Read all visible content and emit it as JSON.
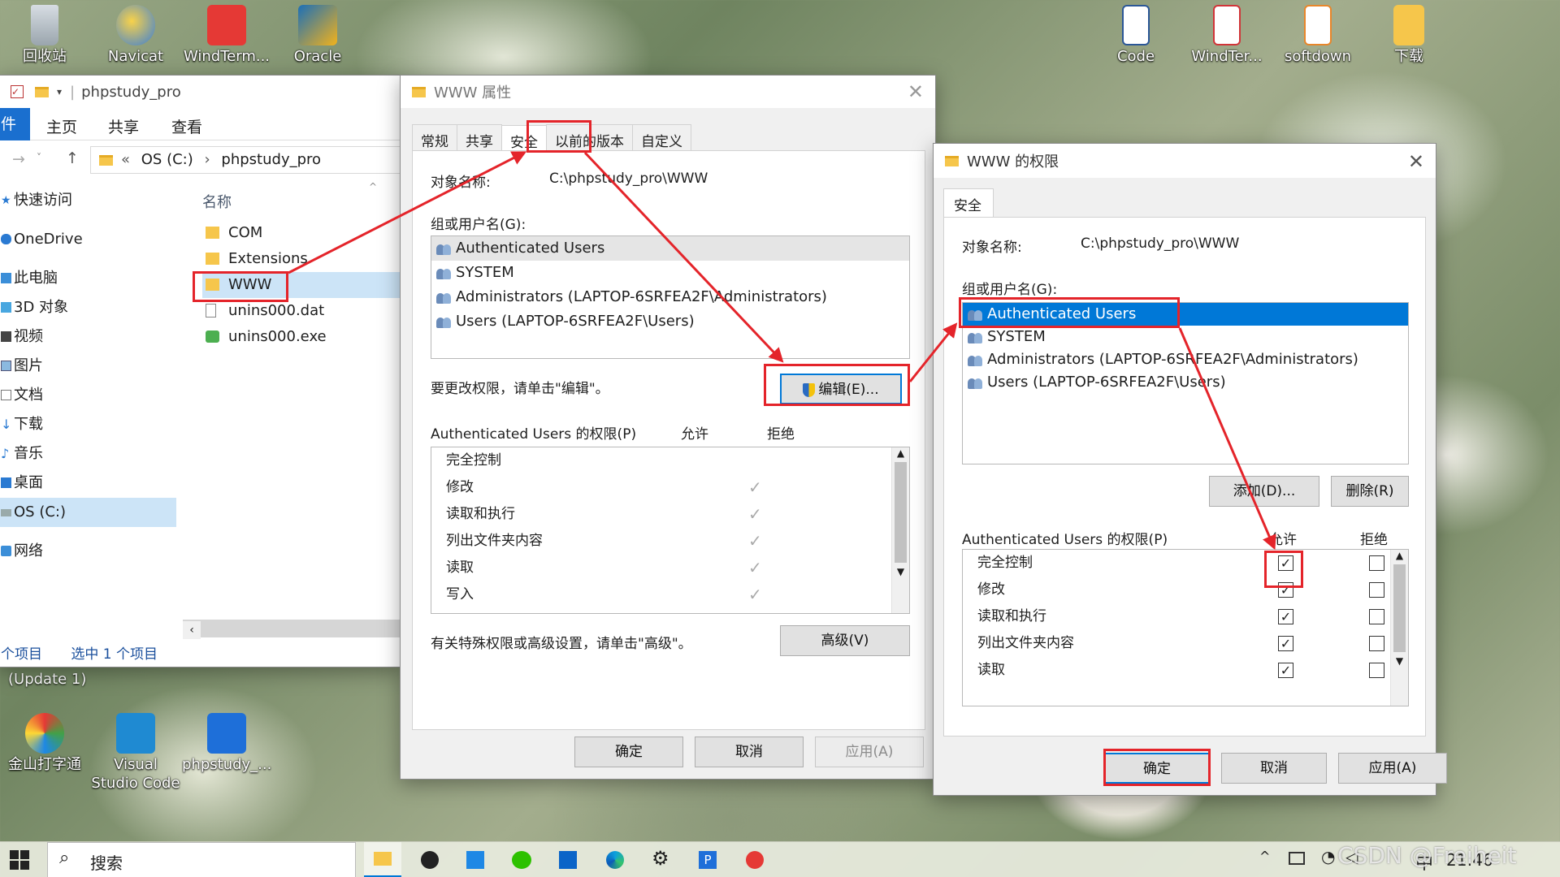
{
  "desktop": {
    "top_icons": [
      "回收站",
      "Navicat",
      "WindTerm...",
      "Oracle"
    ],
    "right_icons": [
      "Code",
      "WindTer...",
      "softdown",
      "下载"
    ],
    "bottom_icons": [
      "金山打字通",
      "Visual Studio Code",
      "phpstudy_..."
    ],
    "update_label": "(Update 1)"
  },
  "explorer": {
    "path": "phpstudy_pro",
    "ribbon": [
      "件",
      "主页",
      "共享",
      "查看"
    ],
    "address": [
      "OS (C:)",
      "phpstudy_pro"
    ],
    "col_name": "名称",
    "nav": [
      "快速访问",
      "OneDrive",
      "此电脑",
      "3D 对象",
      "视频",
      "图片",
      "文档",
      "下载",
      "音乐",
      "桌面",
      "OS (C:)",
      "网络"
    ],
    "files": [
      "COM",
      "Extensions",
      "WWW",
      "unins000.dat",
      "unins000.exe"
    ],
    "status_items": "个项目",
    "status_selected": "选中 1 个项目"
  },
  "props": {
    "title": "WWW 属性",
    "tabs": [
      "常规",
      "共享",
      "安全",
      "以前的版本",
      "自定义"
    ],
    "object_label": "对象名称:",
    "object_value": "C:\\phpstudy_pro\\WWW",
    "group_label": "组或用户名(G):",
    "users": [
      "Authenticated Users",
      "SYSTEM",
      "Administrators (LAPTOP-6SRFEA2F\\Administrators)",
      "Users (LAPTOP-6SRFEA2F\\Users)"
    ],
    "edit_hint": "要更改权限，请单击\"编辑\"。",
    "edit_button": "编辑(E)...",
    "perm_header": "Authenticated Users 的权限(P)",
    "allow": "允许",
    "deny": "拒绝",
    "perms": [
      "完全控制",
      "修改",
      "读取和执行",
      "列出文件夹内容",
      "读取",
      "写入"
    ],
    "advanced_hint": "有关特殊权限或高级设置，请单击\"高级\"。",
    "advanced_button": "高级(V)",
    "ok": "确定",
    "cancel": "取消",
    "apply": "应用(A)"
  },
  "perm_dialog": {
    "title": "WWW 的权限",
    "tab": "安全",
    "object_label": "对象名称:",
    "object_value": "C:\\phpstudy_pro\\WWW",
    "group_label": "组或用户名(G):",
    "users": [
      "Authenticated Users",
      "SYSTEM",
      "Administrators (LAPTOP-6SRFEA2F\\Administrators)",
      "Users (LAPTOP-6SRFEA2F\\Users)"
    ],
    "add_button": "添加(D)...",
    "remove_button": "删除(R)",
    "perm_header": "Authenticated Users 的权限(P)",
    "allow": "允许",
    "deny": "拒绝",
    "perms": [
      "完全控制",
      "修改",
      "读取和执行",
      "列出文件夹内容",
      "读取"
    ],
    "ok": "确定",
    "cancel": "取消",
    "apply": "应用(A)"
  },
  "taskbar": {
    "search": "搜索",
    "ime": "中",
    "clock": "21:46",
    "watermark": "CSDN @Freiheit"
  },
  "colors": {
    "accent": "#0078d7",
    "annotation": "#e4242a"
  }
}
